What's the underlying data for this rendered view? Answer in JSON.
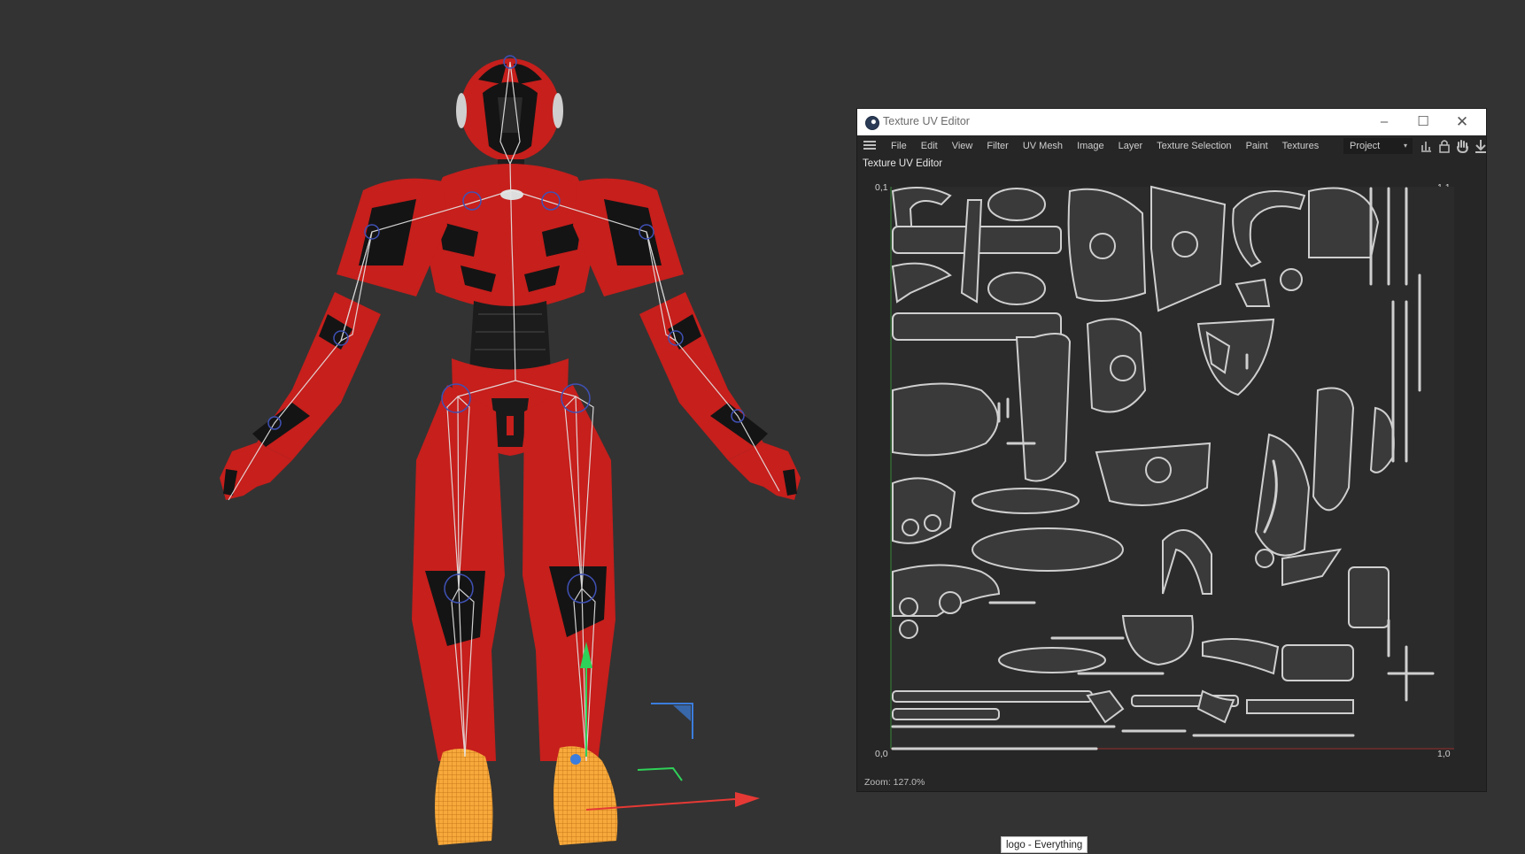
{
  "uv_editor": {
    "title": "Texture UV Editor",
    "panel_title": "Texture UV Editor",
    "menu": [
      "File",
      "Edit",
      "View",
      "Filter",
      "UV Mesh",
      "Image",
      "Layer",
      "Texture Selection",
      "Paint",
      "Textures"
    ],
    "project_select": "Project",
    "coords": {
      "top_left": "0,1",
      "top_right": "1,1",
      "bottom_left": "0,0",
      "bottom_right": "1,0"
    },
    "status": "Zoom: 127.0%",
    "minimize_glyph": "–",
    "maximize_glyph": "☐",
    "close_glyph": "✕",
    "dropdown_glyph": "▾"
  },
  "tooltip": "logo - Everything",
  "icons": [
    "cinema4d-logo-icon",
    "menu-icon",
    "histogram-icon",
    "lock-icon",
    "hand-icon",
    "download-icon"
  ],
  "colors": {
    "viewport_bg": "#333333",
    "armor_red": "#c61f1c",
    "armor_black": "#141414",
    "joint_blue": "#3f51b5",
    "foot_orange": "#f7a93b",
    "uv_line": "#c9c9c9"
  }
}
